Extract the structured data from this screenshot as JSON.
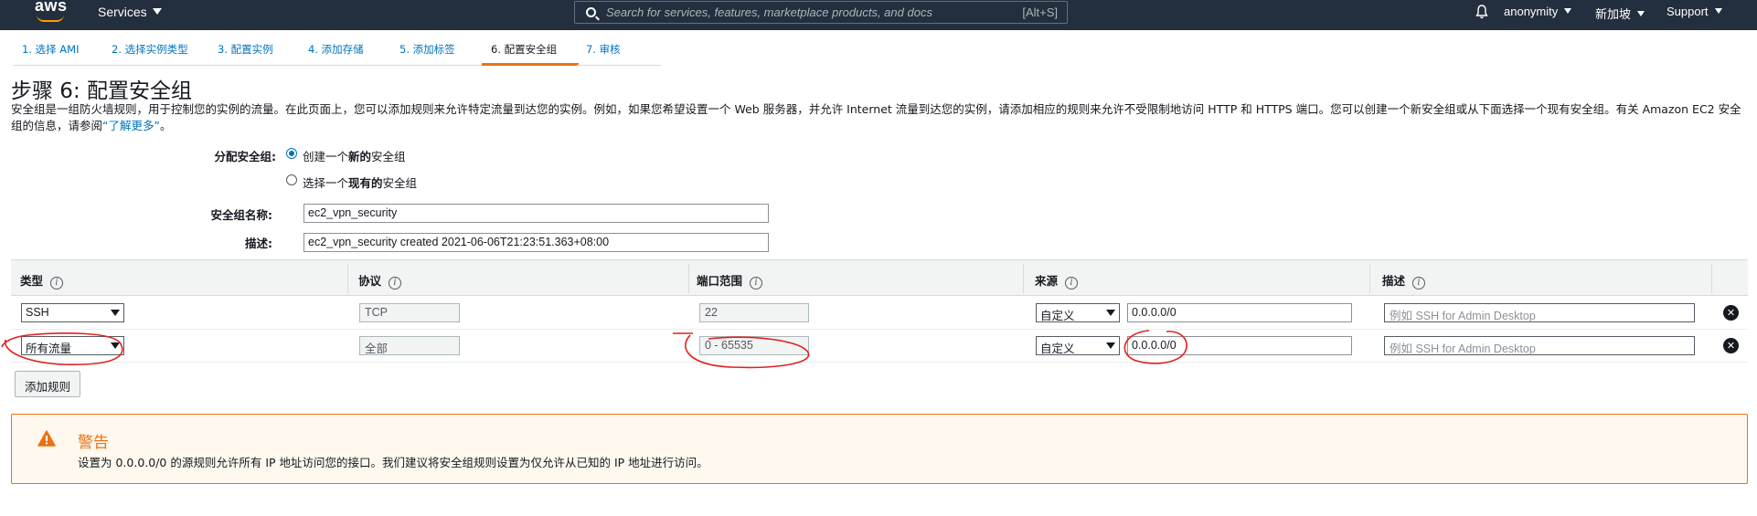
{
  "topnav": {
    "logo": "aws",
    "services": "Services",
    "search_placeholder": "Search for services, features, marketplace products, and docs",
    "search_shortcut": "[Alt+S]",
    "user": "anonymity",
    "region": "新加坡",
    "support": "Support"
  },
  "tabs": [
    {
      "label": "1. 选择 AMI"
    },
    {
      "label": "2. 选择实例类型"
    },
    {
      "label": "3. 配置实例"
    },
    {
      "label": "4. 添加存储"
    },
    {
      "label": "5. 添加标签"
    },
    {
      "label": "6. 配置安全组",
      "active": true
    },
    {
      "label": "7. 审核"
    }
  ],
  "page": {
    "title": "步骤 6: 配置安全组",
    "intro": "安全组是一组防火墙规则，用于控制您的实例的流量。在此页面上，您可以添加规则来允许特定流量到达您的实例。例如，如果您希望设置一个 Web 服务器，并允许 Internet 流量到达您的实例，请添加相应的规则来允许不受限制地访问 HTTP 和 HTTPS 端口。您可以创建一个新安全组或从下面选择一个现有安全组。有关 Amazon EC2 安全组的信息，请参阅",
    "learn_more": "了解更多",
    "intro_end": "。"
  },
  "form": {
    "assign_label": "分配安全组:",
    "radio_new_prefix": "创建一个",
    "radio_new_bold": "新的",
    "radio_new_suffix": "安全组",
    "radio_existing_prefix": "选择一个",
    "radio_existing_bold": "现有的",
    "radio_existing_suffix": "安全组",
    "name_label": "安全组名称:",
    "name_value": "ec2_vpn_security",
    "desc_label": "描述:",
    "desc_value": "ec2_vpn_security created 2021-06-06T21:23:51.363+08:00"
  },
  "table": {
    "headers": {
      "type": "类型",
      "protocol": "协议",
      "port": "端口范围",
      "source": "来源",
      "description": "描述"
    },
    "rows": [
      {
        "type": "SSH",
        "protocol": "TCP",
        "port": "22",
        "source_mode": "自定义",
        "source": "0.0.0.0/0",
        "desc_placeholder": "例如 SSH for Admin Desktop"
      },
      {
        "type": "所有流量",
        "protocol": "全部",
        "port": "0 - 65535",
        "source_mode": "自定义",
        "source": "0.0.0.0/0",
        "desc_placeholder": "例如 SSH for Admin Desktop"
      }
    ],
    "add_rule": "添加规则"
  },
  "warning": {
    "title": "警告",
    "text": "设置为 0.0.0.0/0 的源规则允许所有 IP 地址访问您的接口。我们建议将安全组规则设置为仅允许从已知的 IP 地址进行访问。"
  },
  "colors": {
    "nav_bg": "#232f3e",
    "accent": "#ec7211",
    "link": "#0073bb",
    "annotation": "#e02020"
  }
}
